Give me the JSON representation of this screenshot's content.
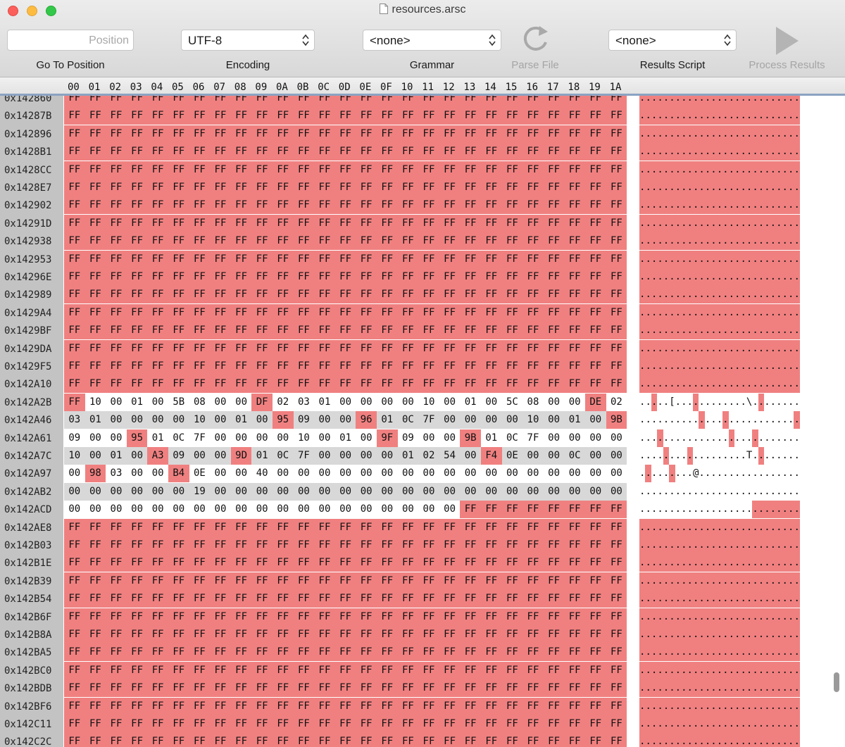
{
  "window": {
    "title": "resources.arsc",
    "file_icon": "document-icon"
  },
  "toolbar": {
    "position_placeholder": "Position",
    "goto_label": "Go To Position",
    "encoding_value": "UTF-8",
    "encoding_label": "Encoding",
    "grammar_value": "<none>",
    "grammar_label": "Grammar",
    "parse_label": "Parse File",
    "parse_icon": "refresh-icon",
    "script_value": "<none>",
    "script_label": "Results Script",
    "process_label": "Process Results",
    "process_icon": "play-icon"
  },
  "columns": [
    "00",
    "01",
    "02",
    "03",
    "04",
    "05",
    "06",
    "07",
    "08",
    "09",
    "0A",
    "0B",
    "0C",
    "0D",
    "0E",
    "0F",
    "10",
    "11",
    "12",
    "13",
    "14",
    "15",
    "16",
    "17",
    "18",
    "19",
    "1A"
  ],
  "colors": {
    "highlight": "#f08080",
    "row_alt": "#d8d8d8",
    "gutter": "#c3c3c3"
  },
  "hex": {
    "top_partial": "0x142860",
    "ff_before": [
      "0x14287B",
      "0x142896",
      "0x1428B1",
      "0x1428CC",
      "0x1428E7",
      "0x142902",
      "0x14291D",
      "0x142938",
      "0x142953",
      "0x14296E",
      "0x142989",
      "0x1429A4",
      "0x1429BF",
      "0x1429DA",
      "0x1429F5",
      "0x142A10"
    ],
    "mixed": [
      {
        "addr": "0x142A2B",
        "bytes": "FF 10 00 01 00 5B 08 00 00 DF 02 03 01 00 00 00 00 10 00 01 00 5C 08 00 00 DE 02",
        "red": [
          0,
          9,
          25
        ],
        "ascii": ".....[............\\.....",
        "ascii_red": [
          2,
          9,
          20
        ]
      },
      {
        "addr": "0x142A46",
        "bytes": "03 01 00 00 00 00 10 00 01 00 95 09 00 00 96 01 0C 7F 00 00 00 00 10 00 01 00 9B",
        "red": [
          10,
          14,
          26
        ],
        "ascii": "..........................",
        "ascii_red": [
          10,
          14,
          26
        ]
      },
      {
        "addr": "0x142A61",
        "bytes": "09 00 00 95 01 0C 7F 00 00 00 00 10 00 01 00 9F 09 00 00 9B 01 0C 7F 00 00 00 00",
        "red": [
          3,
          15,
          19
        ],
        "ascii": "..........................",
        "ascii_red": [
          3,
          15,
          19
        ]
      },
      {
        "addr": "0x142A7C",
        "bytes": "10 00 01 00 A3 09 00 00 9D 01 0C 7F 00 00 00 00 01 02 54 00 F4 0E 00 00 0C 00 00",
        "red": [
          4,
          8,
          20
        ],
        "ascii": "..................T.......",
        "ascii_red": [
          4,
          8,
          20
        ]
      },
      {
        "addr": "0x142A97",
        "bytes": "00 98 03 00 00 B4 0E 00 00 40 00 00 00 00 00 00 00 00 00 00 00 00 00 00 00 00 00",
        "red": [
          1,
          5
        ],
        "ascii": ".........@................",
        "ascii_red": [
          1,
          5
        ]
      },
      {
        "addr": "0x142AB2",
        "bytes": "00 00 00 00 00 00 19 00 00 00 00 00 00 00 00 00 00 00 00 00 00 00 00 00 00 00 00",
        "red": [],
        "ascii": "...........................",
        "ascii_red": []
      },
      {
        "addr": "0x142ACD",
        "bytes": "00 00 00 00 00 00 00 00 00 00 00 00 00 00 00 00 00 00 00 FF FF FF FF FF FF FF FF",
        "red": [
          19,
          20,
          21,
          22,
          23,
          24,
          25,
          26
        ],
        "ascii": "...........................",
        "ascii_red": [
          19,
          20,
          21,
          22,
          23,
          24,
          25,
          26
        ]
      }
    ],
    "ff_after": [
      "0x142AE8",
      "0x142B03",
      "0x142B1E",
      "0x142B39",
      "0x142B54",
      "0x142B6F",
      "0x142B8A",
      "0x142BA5",
      "0x142BC0",
      "0x142BDB",
      "0x142BF6",
      "0x142C11",
      "0x142C2C"
    ]
  }
}
